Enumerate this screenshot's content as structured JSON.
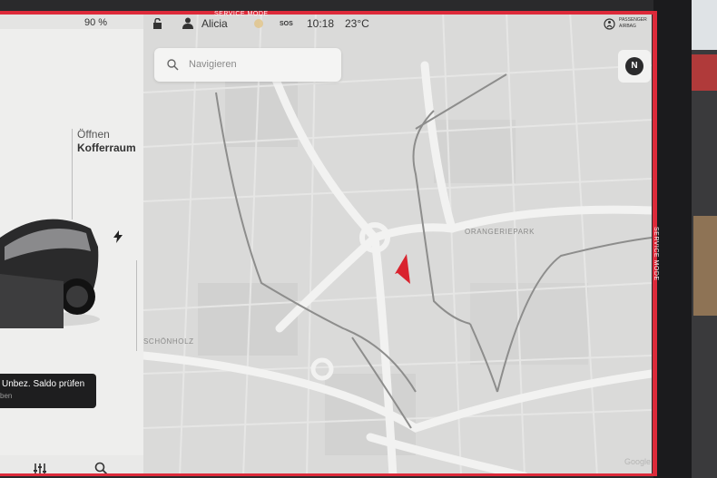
{
  "status_bar": {
    "battery": "90 %",
    "lock_icon": "lock-open-icon",
    "user_icon": "person-icon",
    "driver": "Alicia",
    "sos": "SOS",
    "time": "10:18",
    "temperature": "23°C",
    "airbag_line1": "PASSENGER",
    "airbag_line2": "AIRBAG"
  },
  "service_mode": "SERVICE MODE",
  "navigation": {
    "search_placeholder": "Navigieren",
    "compass_label": "N"
  },
  "vehicle_panel": {
    "trunk_action": "Öffnen",
    "trunk_label": "Kofferraum",
    "charge_icon": "lightning-icon"
  },
  "toast": {
    "title": "Unbez. Saldo prüfen",
    "subtitle": "ben"
  },
  "map": {
    "labels": [
      "ORANGERIEPARK",
      "SCHÖNHOLZ"
    ],
    "watermark": "Google"
  },
  "colors": {
    "service_border": "#dd2a3a",
    "heading_arrow": "#d9232e"
  }
}
